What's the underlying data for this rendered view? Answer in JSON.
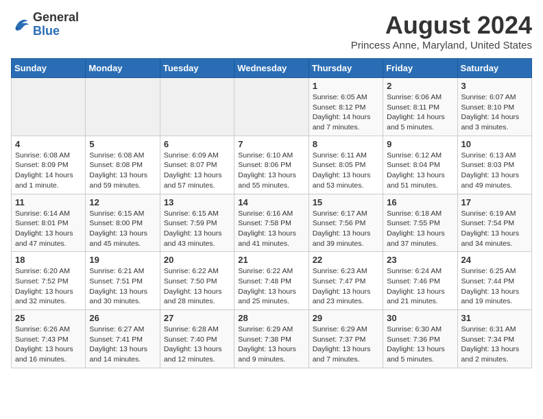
{
  "header": {
    "logo_general": "General",
    "logo_blue": "Blue",
    "month_year": "August 2024",
    "location": "Princess Anne, Maryland, United States"
  },
  "weekdays": [
    "Sunday",
    "Monday",
    "Tuesday",
    "Wednesday",
    "Thursday",
    "Friday",
    "Saturday"
  ],
  "weeks": [
    [
      {
        "day": "",
        "info": ""
      },
      {
        "day": "",
        "info": ""
      },
      {
        "day": "",
        "info": ""
      },
      {
        "day": "",
        "info": ""
      },
      {
        "day": "1",
        "info": "Sunrise: 6:05 AM\nSunset: 8:12 PM\nDaylight: 14 hours\nand 7 minutes."
      },
      {
        "day": "2",
        "info": "Sunrise: 6:06 AM\nSunset: 8:11 PM\nDaylight: 14 hours\nand 5 minutes."
      },
      {
        "day": "3",
        "info": "Sunrise: 6:07 AM\nSunset: 8:10 PM\nDaylight: 14 hours\nand 3 minutes."
      }
    ],
    [
      {
        "day": "4",
        "info": "Sunrise: 6:08 AM\nSunset: 8:09 PM\nDaylight: 14 hours\nand 1 minute."
      },
      {
        "day": "5",
        "info": "Sunrise: 6:08 AM\nSunset: 8:08 PM\nDaylight: 13 hours\nand 59 minutes."
      },
      {
        "day": "6",
        "info": "Sunrise: 6:09 AM\nSunset: 8:07 PM\nDaylight: 13 hours\nand 57 minutes."
      },
      {
        "day": "7",
        "info": "Sunrise: 6:10 AM\nSunset: 8:06 PM\nDaylight: 13 hours\nand 55 minutes."
      },
      {
        "day": "8",
        "info": "Sunrise: 6:11 AM\nSunset: 8:05 PM\nDaylight: 13 hours\nand 53 minutes."
      },
      {
        "day": "9",
        "info": "Sunrise: 6:12 AM\nSunset: 8:04 PM\nDaylight: 13 hours\nand 51 minutes."
      },
      {
        "day": "10",
        "info": "Sunrise: 6:13 AM\nSunset: 8:03 PM\nDaylight: 13 hours\nand 49 minutes."
      }
    ],
    [
      {
        "day": "11",
        "info": "Sunrise: 6:14 AM\nSunset: 8:01 PM\nDaylight: 13 hours\nand 47 minutes."
      },
      {
        "day": "12",
        "info": "Sunrise: 6:15 AM\nSunset: 8:00 PM\nDaylight: 13 hours\nand 45 minutes."
      },
      {
        "day": "13",
        "info": "Sunrise: 6:15 AM\nSunset: 7:59 PM\nDaylight: 13 hours\nand 43 minutes."
      },
      {
        "day": "14",
        "info": "Sunrise: 6:16 AM\nSunset: 7:58 PM\nDaylight: 13 hours\nand 41 minutes."
      },
      {
        "day": "15",
        "info": "Sunrise: 6:17 AM\nSunset: 7:56 PM\nDaylight: 13 hours\nand 39 minutes."
      },
      {
        "day": "16",
        "info": "Sunrise: 6:18 AM\nSunset: 7:55 PM\nDaylight: 13 hours\nand 37 minutes."
      },
      {
        "day": "17",
        "info": "Sunrise: 6:19 AM\nSunset: 7:54 PM\nDaylight: 13 hours\nand 34 minutes."
      }
    ],
    [
      {
        "day": "18",
        "info": "Sunrise: 6:20 AM\nSunset: 7:52 PM\nDaylight: 13 hours\nand 32 minutes."
      },
      {
        "day": "19",
        "info": "Sunrise: 6:21 AM\nSunset: 7:51 PM\nDaylight: 13 hours\nand 30 minutes."
      },
      {
        "day": "20",
        "info": "Sunrise: 6:22 AM\nSunset: 7:50 PM\nDaylight: 13 hours\nand 28 minutes."
      },
      {
        "day": "21",
        "info": "Sunrise: 6:22 AM\nSunset: 7:48 PM\nDaylight: 13 hours\nand 25 minutes."
      },
      {
        "day": "22",
        "info": "Sunrise: 6:23 AM\nSunset: 7:47 PM\nDaylight: 13 hours\nand 23 minutes."
      },
      {
        "day": "23",
        "info": "Sunrise: 6:24 AM\nSunset: 7:46 PM\nDaylight: 13 hours\nand 21 minutes."
      },
      {
        "day": "24",
        "info": "Sunrise: 6:25 AM\nSunset: 7:44 PM\nDaylight: 13 hours\nand 19 minutes."
      }
    ],
    [
      {
        "day": "25",
        "info": "Sunrise: 6:26 AM\nSunset: 7:43 PM\nDaylight: 13 hours\nand 16 minutes."
      },
      {
        "day": "26",
        "info": "Sunrise: 6:27 AM\nSunset: 7:41 PM\nDaylight: 13 hours\nand 14 minutes."
      },
      {
        "day": "27",
        "info": "Sunrise: 6:28 AM\nSunset: 7:40 PM\nDaylight: 13 hours\nand 12 minutes."
      },
      {
        "day": "28",
        "info": "Sunrise: 6:29 AM\nSunset: 7:38 PM\nDaylight: 13 hours\nand 9 minutes."
      },
      {
        "day": "29",
        "info": "Sunrise: 6:29 AM\nSunset: 7:37 PM\nDaylight: 13 hours\nand 7 minutes."
      },
      {
        "day": "30",
        "info": "Sunrise: 6:30 AM\nSunset: 7:36 PM\nDaylight: 13 hours\nand 5 minutes."
      },
      {
        "day": "31",
        "info": "Sunrise: 6:31 AM\nSunset: 7:34 PM\nDaylight: 13 hours\nand 2 minutes."
      }
    ]
  ]
}
